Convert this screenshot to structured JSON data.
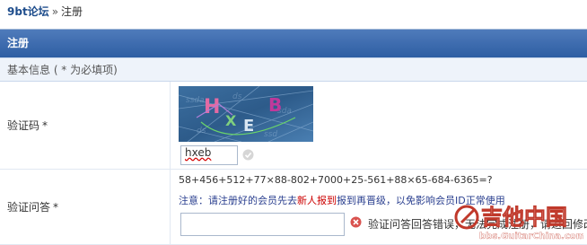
{
  "breadcrumb": {
    "home": "9bt论坛",
    "separator": "»",
    "current": "注册"
  },
  "panel": {
    "title": "注册",
    "section_title": "基本信息 ( * 为必填项)"
  },
  "captcha": {
    "label": "验证码",
    "required_mark": "*",
    "image_text": "HXEB",
    "input_value": "hxeb",
    "status_icon": "check-icon"
  },
  "question": {
    "label": "验证问答",
    "required_mark": "*",
    "text": "58+456+512+77×88-802+7000+25-561+88×65-684-6365=?",
    "note_prefix": "注意：请注册好的会员先去",
    "note_emphasis": "新人报到",
    "note_suffix": "报到再晋级，以免影响会员ID正常使用",
    "input_value": "",
    "error_icon": "error-icon",
    "error_text": "验证问答回答错误，无法完成注册，请返回修改"
  },
  "watermark": {
    "text": "吉他中国",
    "url": "bbs.GuitarChina.com"
  },
  "colors": {
    "header_bg": "#3a69ad",
    "link": "#1e4d8c",
    "note": "#2a3f8f",
    "emphasis": "#cc0000",
    "error": "#d9534f"
  }
}
